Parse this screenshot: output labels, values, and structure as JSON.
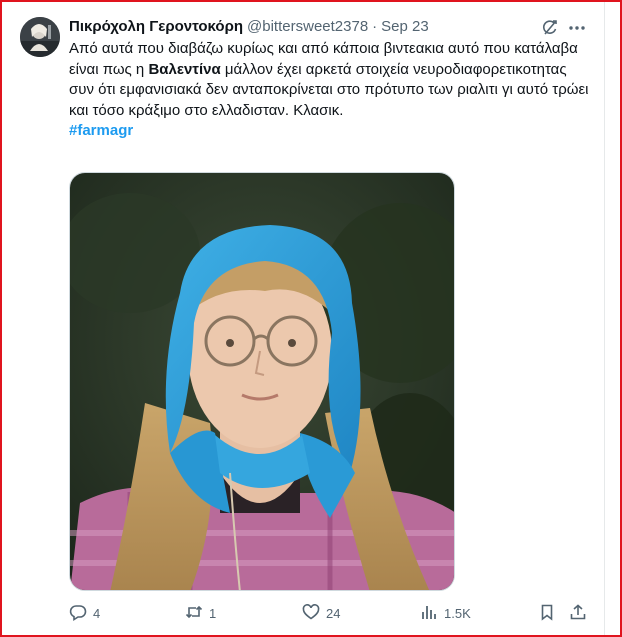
{
  "tweet": {
    "author": {
      "display_name": "Πικρόχολη Γεροντοκόρη",
      "handle": "@bittersweet2378",
      "separator": "·",
      "date": "Sep 23"
    },
    "text": {
      "part1": "Από αυτά που διαβάζω κυρίως και από κάποια βιντεακια αυτό που κατάλαβα είναι πως η ",
      "bold_name": "Βαλεντίνα",
      "part2": " μάλλον έχει αρκετά στοιχεία νευροδιαφορετικοτητας συν ότι εμφανισιακά δεν ανταποκρίνεται στο πρότυπο των ριαλιτι γι αυτό τρώει και τόσο κράξιμο στο ελλαδισταν. Κλασικ.",
      "hashtag": "#farmagr"
    },
    "actions": {
      "replies": "4",
      "reposts": "1",
      "likes": "24",
      "views": "1.5K"
    }
  },
  "icons": {
    "header": [
      "grok-icon",
      "more-icon"
    ],
    "actions": [
      "reply-icon",
      "repost-icon",
      "like-icon",
      "views-icon",
      "bookmark-icon",
      "share-icon"
    ]
  },
  "colors": {
    "accent": "#1d9bf0",
    "muted_text": "#536471",
    "frame_border": "#e0141e",
    "headscarf": "#2e9fd8"
  }
}
